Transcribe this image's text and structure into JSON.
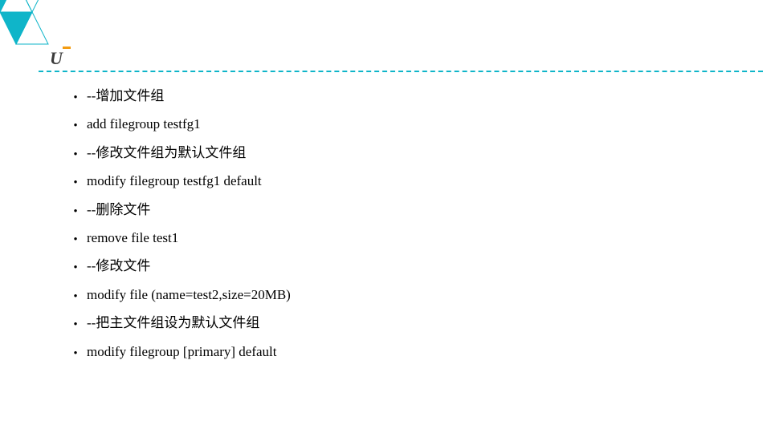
{
  "bullet_items": [
    "--增加文件组",
    "add filegroup testfg1",
    "--修改文件组为默认文件组",
    "modify filegroup testfg1 default",
    "--删除文件",
    "remove file test1",
    "--修改文件",
    "modify file (name=test2,size=20MB)",
    "--把主文件组设为默认文件组",
    "modify filegroup [primary] default"
  ]
}
